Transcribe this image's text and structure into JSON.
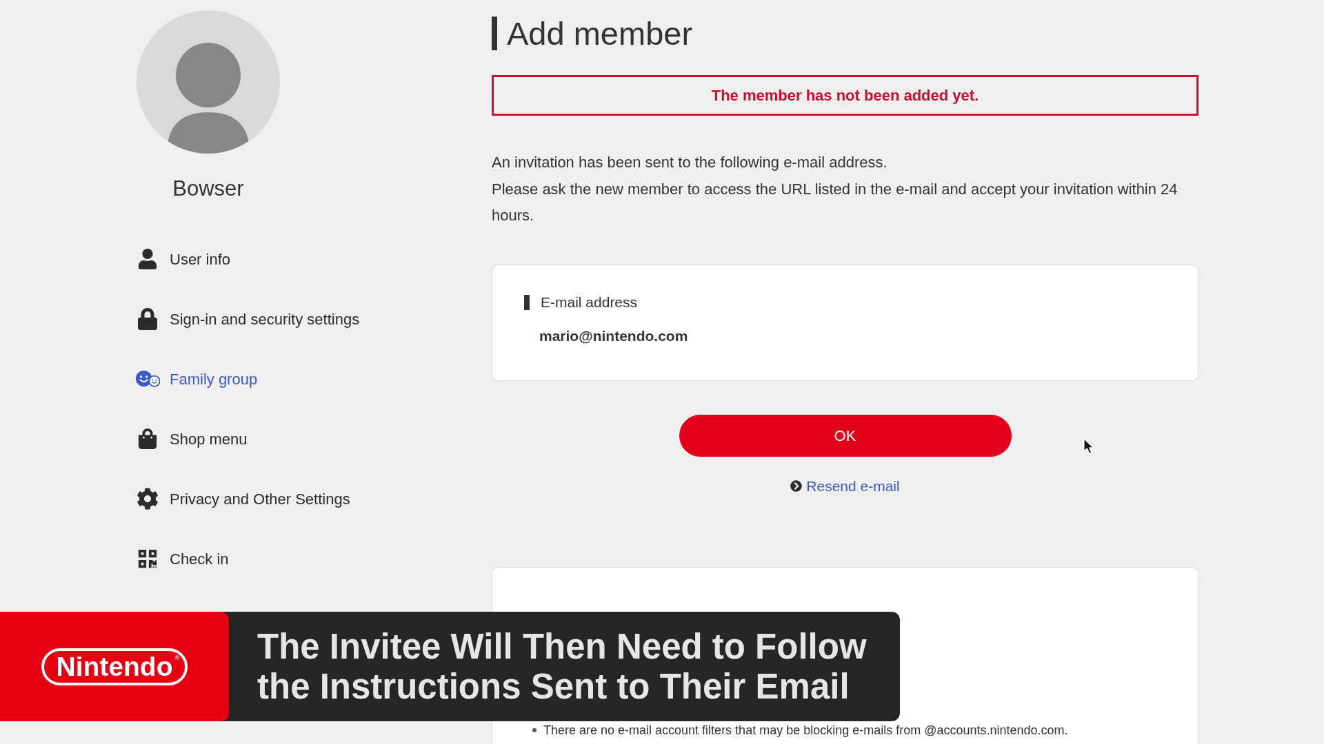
{
  "profile": {
    "name": "Bowser"
  },
  "sidebar": {
    "items": [
      {
        "label": "User info",
        "selected": false
      },
      {
        "label": "Sign-in and security settings",
        "selected": false
      },
      {
        "label": "Family group",
        "selected": true
      },
      {
        "label": "Shop menu",
        "selected": false
      },
      {
        "label": "Privacy and Other Settings",
        "selected": false
      },
      {
        "label": "Check in",
        "selected": false
      }
    ]
  },
  "page": {
    "title": "Add member",
    "notice": "The member has not been added yet.",
    "paragraphs": [
      "An invitation has been sent to the following e-mail address.",
      "Please ask the new member to access the URL listed in the e-mail and accept your invitation within 24 hours."
    ],
    "email_card": {
      "label": "E-mail address",
      "value": "mario@nintendo.com"
    },
    "ok_button": "OK",
    "resend_link": "Resend e-mail",
    "help_card": {
      "bullets": [
        "There are no e-mail account filters that may be blocking e-mails from @accounts.nintendo.com."
      ]
    }
  },
  "caption_banner": {
    "logo": {
      "wordmark": "Nintendo",
      "mark": "®"
    },
    "lines": [
      "The Invitee Will Then Need to Follow",
      "the Instructions Sent to Their Email"
    ]
  }
}
